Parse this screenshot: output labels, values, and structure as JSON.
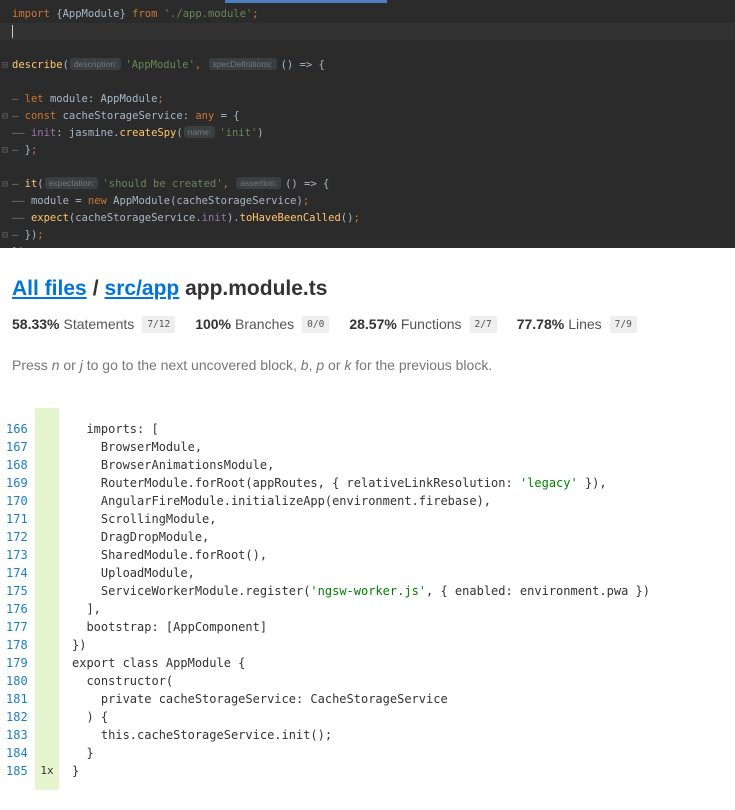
{
  "editor": {
    "lines": [
      {
        "gutter": "",
        "current": false,
        "tokens": [
          {
            "t": "import ",
            "c": "kw"
          },
          {
            "t": "{AppModule} ",
            "c": "pl"
          },
          {
            "t": "from ",
            "c": "kw"
          },
          {
            "t": "'./app.module'",
            "c": "str"
          },
          {
            "t": ";",
            "c": "kw"
          }
        ]
      },
      {
        "gutter": "",
        "current": true,
        "cursor": true,
        "tokens": []
      },
      {
        "gutter": "",
        "current": false,
        "tokens": []
      },
      {
        "gutter": "⊟",
        "current": false,
        "tokens": [
          {
            "t": "describe",
            "c": "fn"
          },
          {
            "t": "(",
            "c": "pl"
          },
          {
            "t": "description:",
            "c": "hint"
          },
          {
            "t": "'AppModule'",
            "c": "str"
          },
          {
            "t": ", ",
            "c": "kw"
          },
          {
            "t": "specDefinitions:",
            "c": "hint"
          },
          {
            "t": "() => {",
            "c": "pl"
          }
        ]
      },
      {
        "gutter": "",
        "current": false,
        "tokens": []
      },
      {
        "gutter": "",
        "current": false,
        "tokens": [
          {
            "t": "—",
            "c": "ft"
          },
          {
            "t": " let ",
            "c": "kw"
          },
          {
            "t": "module: AppModule",
            "c": "pl"
          },
          {
            "t": ";",
            "c": "kw"
          }
        ]
      },
      {
        "gutter": "⊟",
        "current": false,
        "tokens": [
          {
            "t": "—",
            "c": "ft"
          },
          {
            "t": " const ",
            "c": "kw"
          },
          {
            "t": "cacheStorageService: ",
            "c": "pl"
          },
          {
            "t": "any",
            "c": "kw"
          },
          {
            "t": " = {",
            "c": "pl"
          }
        ]
      },
      {
        "gutter": "",
        "current": false,
        "tokens": [
          {
            "t": "—— ",
            "c": "ft"
          },
          {
            "t": "init",
            "c": "prop"
          },
          {
            "t": ": jasmine.",
            "c": "pl"
          },
          {
            "t": "createSpy",
            "c": "fn"
          },
          {
            "t": "(",
            "c": "pl"
          },
          {
            "t": "name:",
            "c": "hint"
          },
          {
            "t": "'init'",
            "c": "str"
          },
          {
            "t": ")",
            "c": "pl"
          }
        ]
      },
      {
        "gutter": "⊟",
        "current": false,
        "tokens": [
          {
            "t": "—",
            "c": "ft"
          },
          {
            "t": " }",
            "c": "pl"
          },
          {
            "t": ";",
            "c": "kw"
          }
        ]
      },
      {
        "gutter": "",
        "current": false,
        "tokens": []
      },
      {
        "gutter": "⊟",
        "current": false,
        "tokens": [
          {
            "t": "—",
            "c": "ft"
          },
          {
            "t": " it",
            "c": "fn"
          },
          {
            "t": "(",
            "c": "pl"
          },
          {
            "t": "expectation:",
            "c": "hint"
          },
          {
            "t": "'should be created'",
            "c": "str"
          },
          {
            "t": ", ",
            "c": "kw"
          },
          {
            "t": "assertion:",
            "c": "hint"
          },
          {
            "t": "() => {",
            "c": "pl"
          }
        ]
      },
      {
        "gutter": "",
        "current": false,
        "tokens": [
          {
            "t": "—— ",
            "c": "ft"
          },
          {
            "t": "module = ",
            "c": "pl"
          },
          {
            "t": "new ",
            "c": "kw"
          },
          {
            "t": "AppModule(cacheStorageService)",
            "c": "pl"
          },
          {
            "t": ";",
            "c": "kw"
          }
        ]
      },
      {
        "gutter": "",
        "current": false,
        "tokens": [
          {
            "t": "—— ",
            "c": "ft"
          },
          {
            "t": "expect",
            "c": "fn"
          },
          {
            "t": "(cacheStorageService.",
            "c": "pl"
          },
          {
            "t": "init",
            "c": "prop"
          },
          {
            "t": ").",
            "c": "pl"
          },
          {
            "t": "toHaveBeenCalled",
            "c": "fn"
          },
          {
            "t": "()",
            "c": "pl"
          },
          {
            "t": ";",
            "c": "kw"
          }
        ]
      },
      {
        "gutter": "⊟",
        "current": false,
        "tokens": [
          {
            "t": "—",
            "c": "ft"
          },
          {
            "t": " })",
            "c": "pl"
          },
          {
            "t": ";",
            "c": "kw"
          }
        ]
      },
      {
        "gutter": "⊟",
        "current": false,
        "tokens": [
          {
            "t": "})",
            "c": "pl"
          },
          {
            "t": ";",
            "c": "kw"
          }
        ]
      }
    ]
  },
  "coverage": {
    "breadcrumb": {
      "all_files": "All files",
      "separator": "/",
      "dir": "src/app",
      "file": "app.module.ts"
    },
    "stats": [
      {
        "pct": "58.33%",
        "label": "Statements",
        "frac": "7/12"
      },
      {
        "pct": "100%",
        "label": "Branches",
        "frac": "0/0"
      },
      {
        "pct": "28.57%",
        "label": "Functions",
        "frac": "2/7"
      },
      {
        "pct": "77.78%",
        "label": "Lines",
        "frac": "7/9"
      }
    ],
    "hint": [
      {
        "t": "Press ",
        "em": false
      },
      {
        "t": "n",
        "em": true
      },
      {
        "t": " or ",
        "em": false
      },
      {
        "t": "j",
        "em": true
      },
      {
        "t": " to go to the next uncovered block, ",
        "em": false
      },
      {
        "t": "b",
        "em": true
      },
      {
        "t": ", ",
        "em": false
      },
      {
        "t": "p",
        "em": true
      },
      {
        "t": " or ",
        "em": false
      },
      {
        "t": "k",
        "em": true
      },
      {
        "t": " for the previous block.",
        "em": false
      }
    ]
  },
  "listing": {
    "rows": [
      {
        "n": "166",
        "hit": "",
        "code": [
          {
            "t": "  imports: [",
            "c": ""
          }
        ]
      },
      {
        "n": "167",
        "hit": "",
        "code": [
          {
            "t": "    BrowserModule,",
            "c": ""
          }
        ]
      },
      {
        "n": "168",
        "hit": "",
        "code": [
          {
            "t": "    BrowserAnimationsModule,",
            "c": ""
          }
        ]
      },
      {
        "n": "169",
        "hit": "",
        "code": [
          {
            "t": "    RouterModule.forRoot(appRoutes, { relativeLinkResolution: ",
            "c": ""
          },
          {
            "t": "'legacy'",
            "c": "tok-str"
          },
          {
            "t": " }),",
            "c": ""
          }
        ]
      },
      {
        "n": "170",
        "hit": "",
        "code": [
          {
            "t": "    AngularFireModule.initializeApp(environment.firebase),",
            "c": ""
          }
        ]
      },
      {
        "n": "171",
        "hit": "",
        "code": [
          {
            "t": "    ScrollingModule,",
            "c": ""
          }
        ]
      },
      {
        "n": "172",
        "hit": "",
        "code": [
          {
            "t": "    DragDropModule,",
            "c": ""
          }
        ]
      },
      {
        "n": "173",
        "hit": "",
        "code": [
          {
            "t": "    SharedModule.forRoot(),",
            "c": ""
          }
        ]
      },
      {
        "n": "174",
        "hit": "",
        "code": [
          {
            "t": "    UploadModule,",
            "c": ""
          }
        ]
      },
      {
        "n": "175",
        "hit": "",
        "code": [
          {
            "t": "    ServiceWorkerModule.register(",
            "c": ""
          },
          {
            "t": "'ngsw-worker.js'",
            "c": "tok-str"
          },
          {
            "t": ", { enabled: environment.pwa })",
            "c": ""
          }
        ]
      },
      {
        "n": "176",
        "hit": "",
        "code": [
          {
            "t": "  ],",
            "c": ""
          }
        ]
      },
      {
        "n": "177",
        "hit": "",
        "code": [
          {
            "t": "  bootstrap: [AppComponent]",
            "c": ""
          }
        ]
      },
      {
        "n": "178",
        "hit": "",
        "code": [
          {
            "t": "})",
            "c": ""
          }
        ]
      },
      {
        "n": "179",
        "hit": "",
        "code": [
          {
            "t": "export class AppModule {",
            "c": ""
          }
        ]
      },
      {
        "n": "180",
        "hit": "",
        "code": [
          {
            "t": "  constructor(",
            "c": ""
          }
        ]
      },
      {
        "n": "181",
        "hit": "",
        "code": [
          {
            "t": "    private cacheStorageService: CacheStorageService",
            "c": ""
          }
        ]
      },
      {
        "n": "182",
        "hit": "",
        "code": [
          {
            "t": "  ) {",
            "c": ""
          }
        ]
      },
      {
        "n": "183",
        "hit": "",
        "code": [
          {
            "t": "    this.cacheStorageService.init();",
            "c": ""
          }
        ]
      },
      {
        "n": "184",
        "hit": "",
        "code": [
          {
            "t": "  }",
            "c": ""
          }
        ]
      },
      {
        "n": "185",
        "hit": "1x",
        "code": [
          {
            "t": "}",
            "c": ""
          }
        ]
      }
    ]
  }
}
